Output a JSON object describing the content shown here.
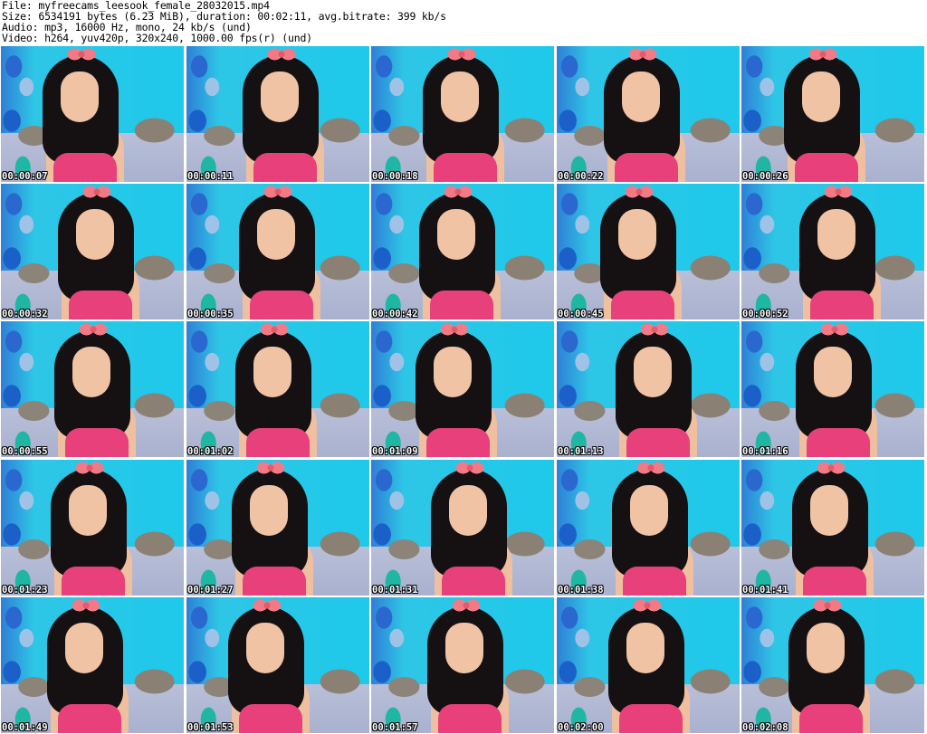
{
  "header": {
    "file_line": "File: myfreecams_leesook_female_28032015.mp4",
    "size_line": "Size: 6534191 bytes (6.23 MiB), duration: 00:02:11, avg.bitrate: 399 kb/s",
    "audio_line": "Audio: mp3, 16000 Hz, mono, 24 kb/s (und)",
    "video_line": "Video: h264, yuv420p, 320x240, 1000.00 fps(r) (und)"
  },
  "colors": {
    "wall_cyan": "#1ec9ea",
    "balloon_blue": "#1b5fc9",
    "balloon_teal": "#1fb7a3",
    "pillow_gray": "#8a8174",
    "bra_pink": "#e8407a",
    "hair_black": "#151012",
    "skin": "#f0c3a5"
  },
  "thumbnails": [
    "00:00:07",
    "00:00:11",
    "00:00:18",
    "00:00:22",
    "00:00:26",
    "00:00:32",
    "00:00:35",
    "00:00:42",
    "00:00:45",
    "00:00:52",
    "00:00:55",
    "00:01:02",
    "00:01:09",
    "00:01:13",
    "00:01:16",
    "00:01:23",
    "00:01:27",
    "00:01:31",
    "00:01:38",
    "00:01:41",
    "00:01:49",
    "00:01:53",
    "00:01:57",
    "00:02:00",
    "00:02:08"
  ]
}
